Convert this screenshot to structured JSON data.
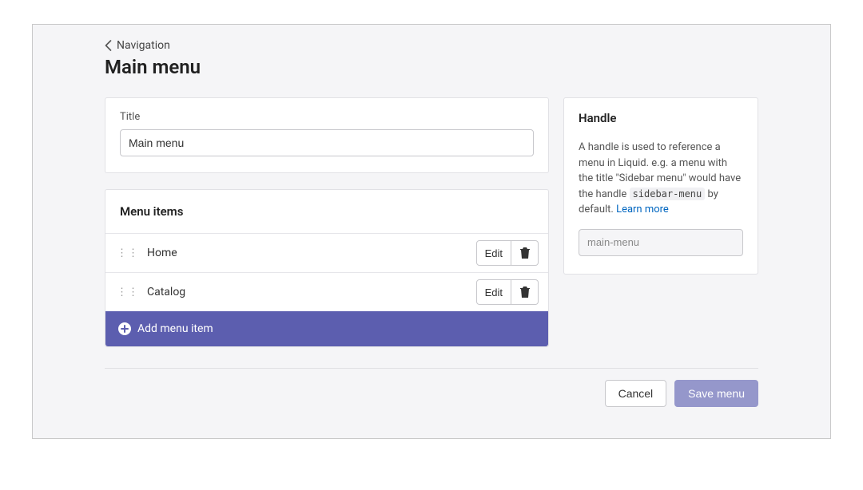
{
  "breadcrumb": {
    "label": "Navigation"
  },
  "page": {
    "title": "Main menu"
  },
  "title_card": {
    "label": "Title",
    "value": "Main menu"
  },
  "menu_items": {
    "heading": "Menu items",
    "items": [
      {
        "name": "Home",
        "edit_label": "Edit"
      },
      {
        "name": "Catalog",
        "edit_label": "Edit"
      }
    ],
    "add_label": "Add menu item"
  },
  "handle": {
    "heading": "Handle",
    "desc_1": "A handle is used to reference a menu in Liquid. e.g. a menu with the title \"Sidebar menu\" would have the handle ",
    "code": "sidebar-menu",
    "desc_2": " by default. ",
    "learn_more": "Learn more",
    "value": "main-menu"
  },
  "footer": {
    "cancel": "Cancel",
    "save": "Save menu"
  }
}
